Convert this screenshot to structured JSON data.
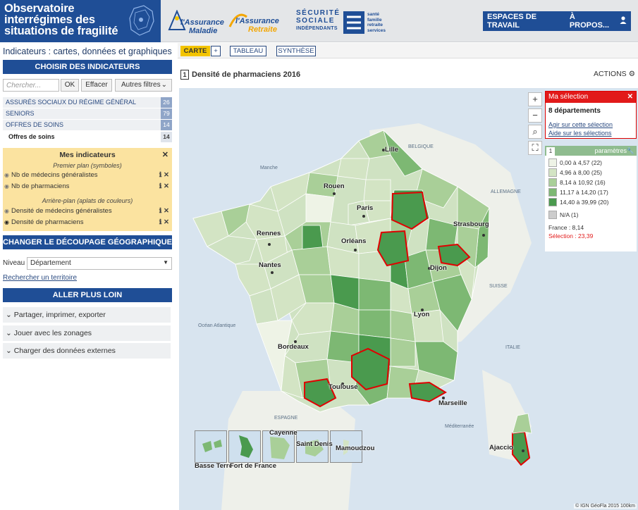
{
  "header": {
    "brand_line1": "Observatoire",
    "brand_line2": "interrégimes des",
    "brand_line3": "situations de fragilité",
    "logo_am": "l'Assurance Maladie",
    "logo_am_line1": "l'Assurance",
    "logo_am_line2": "Maladie",
    "logo_ar_line1": "l'Assurance",
    "logo_ar_line2": "Retraite",
    "logo_ssi_line1": "SÉCURITÉ",
    "logo_ssi_line2": "SOCIALE",
    "logo_ssi_line3": "INDÉPENDANTS",
    "logo_msa_txt1": "santé",
    "logo_msa_txt2": "famille",
    "logo_msa_txt3": "retraite",
    "logo_msa_txt4": "services",
    "btn_espaces": "ESPACES DE TRAVAIL",
    "btn_apropos": "À PROPOS...",
    "user_icon": "user-icon"
  },
  "left": {
    "title": "Indicateurs : cartes, données et graphiques",
    "choose_bar": "CHOISIR DES INDICATEURS",
    "search_placeholder": "Chercher...",
    "ok": "OK",
    "effacer": "Effacer",
    "autres_filtres": "Autres filtres",
    "categories": [
      {
        "label": "ASSURÉS SOCIAUX DU RÉGIME GÉNÉRAL",
        "count": "26"
      },
      {
        "label": "SENIORS",
        "count": "79"
      },
      {
        "label": "OFFRES DE SOINS",
        "count": "14"
      },
      {
        "label": "Offres de soins",
        "count": "14"
      }
    ],
    "mes_indicateurs": {
      "title": "Mes indicateurs",
      "premier_plan": "Premier plan (symboles)",
      "items_fg": [
        "Nb de médecins généralistes",
        "Nb de pharmaciens"
      ],
      "arriere_plan": "Arrière-plan (aplats de couleurs)",
      "items_bg": [
        "Densité de médecins généralistes",
        "Densité de pharmaciens"
      ]
    },
    "decoupage_bar": "CHANGER LE DÉCOUPAGE GÉOGRAPHIQUE",
    "niveau_label": "Niveau",
    "niveau_value": "Département",
    "rechercher": "Rechercher un territoire",
    "plus_loin_bar": "ALLER PLUS LOIN",
    "accordions": [
      "Partager, imprimer, exporter",
      "Jouer avec les zonages",
      "Charger des données externes"
    ]
  },
  "main": {
    "tabs": [
      "CARTE",
      "+",
      "TABLEAU",
      "SYNTHÈSE"
    ],
    "map_num": "1",
    "map_title": "Densité de pharmaciens 2016",
    "actions": "ACTIONS",
    "selection": {
      "title": "Ma sélection",
      "count": "8 départements",
      "link1": "Agir sur cette sélection",
      "link2": "Aide sur les sélections"
    },
    "legend": {
      "num": "1",
      "params": "paramètres",
      "classes": [
        {
          "label": "0,00 à 4,57 (22)",
          "color": "#eef3e6"
        },
        {
          "label": "4,96 à 8,00 (25)",
          "color": "#d3e4c4"
        },
        {
          "label": "8,14 à 10,92 (16)",
          "color": "#a9cf98"
        },
        {
          "label": "11,17 à 14,20 (17)",
          "color": "#7db873"
        },
        {
          "label": "14,40 à 39,99 (20)",
          "color": "#4a9a4e"
        },
        {
          "label": "N/A (1)",
          "color": "#cccccc"
        }
      ],
      "france": "France : 8,14",
      "selection": "Sélection : 23,39"
    },
    "cities": [
      "Lille",
      "Rouen",
      "Paris",
      "Strasbourg",
      "Rennes",
      "Orléans",
      "Nantes",
      "Dijon",
      "Lyon",
      "Bordeaux",
      "Toulouse",
      "Marseille",
      "Ajaccio"
    ],
    "seas": [
      "Manche",
      "BELGIQUE",
      "ALLEMAGNE",
      "SUISSE",
      "ITALIE",
      "ESPAGNE",
      "Océan Atlantique",
      "Méditerranée"
    ],
    "insets": [
      "Basse Terre",
      "Fort de France",
      "Cayenne",
      "Saint Denis",
      "Mamoudzou"
    ],
    "credit": "© IGN GéoFla 2015   100km"
  }
}
